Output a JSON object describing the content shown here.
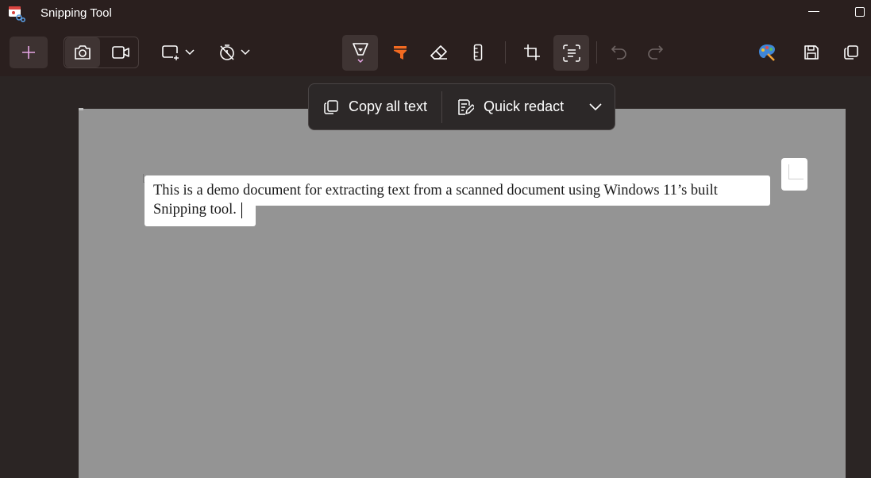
{
  "window": {
    "title": "Snipping Tool"
  },
  "toolbar": {
    "new_icon": "plus-icon",
    "modes": [
      "camera-icon",
      "video-camera-icon"
    ],
    "tools": [
      "ballpoint-pen-icon",
      "highlighter-icon",
      "eraser-icon",
      "ruler-icon",
      "crop-icon",
      "text-actions-icon",
      "undo-icon",
      "redo-icon",
      "paint-icon",
      "save-icon",
      "copy-icon"
    ],
    "accent": "#e7a6e5",
    "highlighter_color": "#f26a21"
  },
  "text_actions": {
    "copy_all_label": "Copy all text",
    "quick_redact_label": "Quick redact"
  },
  "document": {
    "line1": "This is a demo document for extracting text from a scanned document using Windows 11’s built",
    "line2": "Snipping tool."
  }
}
